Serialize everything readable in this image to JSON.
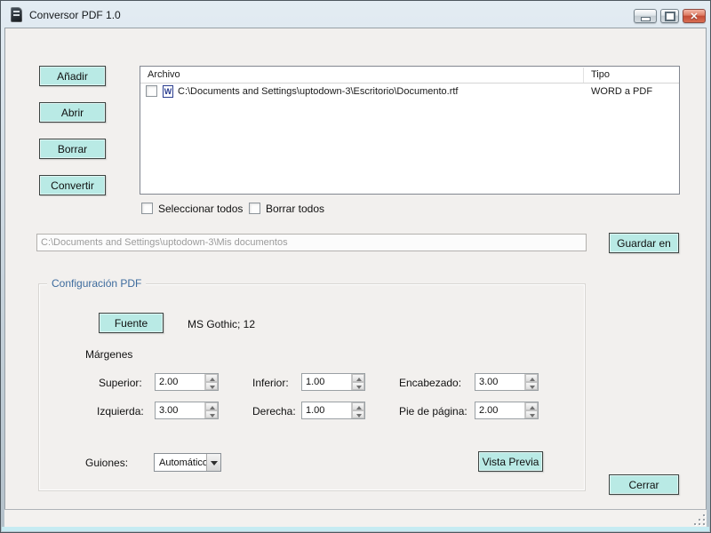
{
  "window": {
    "title": "Conversor PDF 1.0"
  },
  "actions": {
    "add": "Añadir",
    "open": "Abrir",
    "delete": "Borrar",
    "convert": "Convertir"
  },
  "file_list": {
    "columns": [
      "Archivo",
      "Tipo"
    ],
    "rows": [
      {
        "archivo": "C:\\Documents and Settings\\uptodown-3\\Escritorio\\Documento.rtf",
        "tipo": "WORD a PDF",
        "checked": false
      }
    ]
  },
  "list_options": {
    "select_all": "Seleccionar todos",
    "clear_all": "Borrar todos"
  },
  "output": {
    "path": "C:\\Documents and Settings\\uptodown-3\\Mis documentos",
    "save_button": "Guardar en"
  },
  "config": {
    "title": "Configuración PDF",
    "font_button": "Fuente",
    "font_value": "MS Gothic; 12",
    "margins_label": "Márgenes",
    "fields": [
      {
        "label": "Superior:",
        "value": "2.00"
      },
      {
        "label": "Inferior:",
        "value": "1.00"
      },
      {
        "label": "Encabezado:",
        "value": "3.00"
      },
      {
        "label": "Izquierda:",
        "value": "3.00"
      },
      {
        "label": "Derecha:",
        "value": "1.00"
      },
      {
        "label": "Pie de página:",
        "value": "2.00"
      }
    ],
    "hyphens_label": "Guiones:",
    "hyphens_value": "Automático",
    "preview_button": "Vista Previa"
  },
  "footer": {
    "close_button": "Cerrar"
  },
  "colors": {
    "accent_button": "#b9eae5",
    "titlebar_top": "#e3ecf3",
    "titlebar_bottom": "#b4c1ca",
    "close_button_red": "#d96e52",
    "groupbox_label_blue": "#3d6b9d",
    "content_background": "#f2f0ee"
  }
}
